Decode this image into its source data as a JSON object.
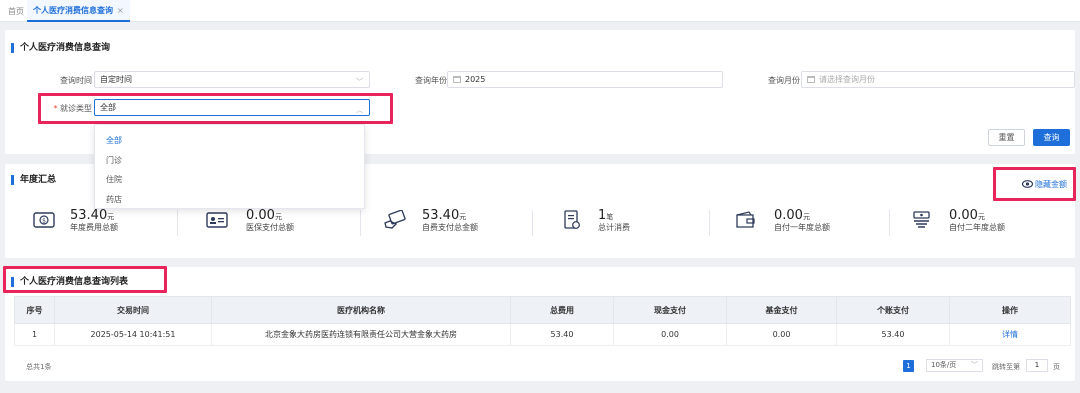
{
  "tabs": {
    "home": "首页",
    "active": "个人医疗消费信息查询",
    "close": "×"
  },
  "search": {
    "title": "个人医疗消费信息查询",
    "time_label": "查询时间",
    "time_value": "自定时间",
    "year_label": "查询年份",
    "year_value": "2025",
    "month_label": "查询月份",
    "month_placeholder": "请选择查询月份",
    "type_required": "*",
    "type_label": "就诊类型",
    "type_value": "全部",
    "type_options": [
      "全部",
      "门诊",
      "住院",
      "药店"
    ],
    "reset_label": "重置",
    "query_label": "查询"
  },
  "summary": {
    "title": "年度汇总",
    "toggle_label": "隐藏金额",
    "stats": [
      {
        "value": "53.40",
        "unit": "元",
        "label": "年度费用总额",
        "icon": "money-card-icon"
      },
      {
        "value": "0.00",
        "unit": "元",
        "label": "医保支付总额",
        "icon": "insurance-card-icon"
      },
      {
        "value": "53.40",
        "unit": "元",
        "label": "自费支付总金额",
        "icon": "cash-hand-icon"
      },
      {
        "value": "1",
        "unit": "笔",
        "label": "总计消费",
        "icon": "receipt-icon"
      },
      {
        "value": "0.00",
        "unit": "元",
        "label": "自付一年度总额",
        "icon": "wallet-icon"
      },
      {
        "value": "0.00",
        "unit": "元",
        "label": "自付二年度总额",
        "icon": "coins-icon"
      }
    ]
  },
  "list": {
    "title": "个人医疗消费信息查询列表",
    "columns": [
      "序号",
      "交易时间",
      "医疗机构名称",
      "总费用",
      "现金支付",
      "基金支付",
      "个账支付",
      "操作"
    ],
    "rows": [
      [
        "1",
        "2025-05-14 10:41:51",
        "北京金象大药房医药连锁有限责任公司大营金象大药房",
        "53.40",
        "0.00",
        "0.00",
        "53.40",
        "详情"
      ]
    ],
    "total_text": "总共1条",
    "page": "1",
    "page_size": "10条/页",
    "jump_label": "跳转至第",
    "jump_value": "1",
    "jump_suffix": "页"
  },
  "colors": {
    "accent": "#1e6fd9",
    "highlight": "#e8245a"
  }
}
